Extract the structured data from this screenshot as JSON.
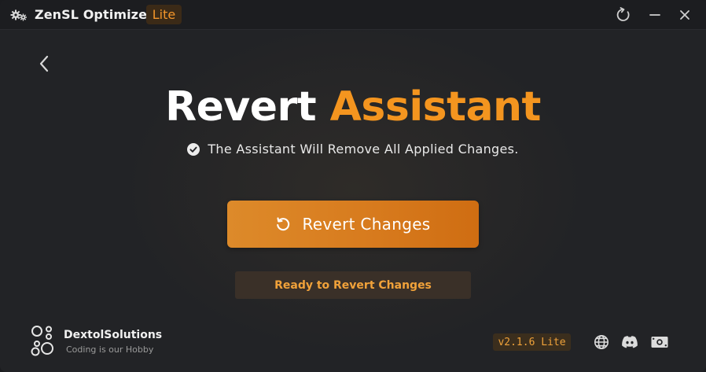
{
  "window": {
    "title": "ZenSL Optimizer",
    "badge": "Lite",
    "controls": {
      "refresh_icon": "refresh-icon",
      "minimize_icon": "minimize-icon",
      "close_icon": "close-icon"
    },
    "app_icon": "gears-icon"
  },
  "nav": {
    "back_icon": "chevron-left-icon"
  },
  "main": {
    "heading_word1": "Revert",
    "heading_word2": "Assistant",
    "subline": "The Assistant Will Remove All Applied Changes.",
    "subline_icon": "check-circle-icon",
    "revert_button_label": "Revert Changes",
    "revert_button_icon": "undo-icon",
    "status": "Ready to Revert Changes"
  },
  "footer": {
    "brand_name": "DextolSolutions",
    "brand_tagline": "Coding is our Hobby",
    "version": "v2.1.6 Lite",
    "links": [
      "globe-icon",
      "discord-icon",
      "money-icon"
    ]
  },
  "colors": {
    "accent": "#f4951f",
    "background": "#222326",
    "titlebar": "#1c1d20",
    "button": "#d77a1d",
    "status_bg": "#3a3028",
    "status_text": "#f1a23a"
  }
}
